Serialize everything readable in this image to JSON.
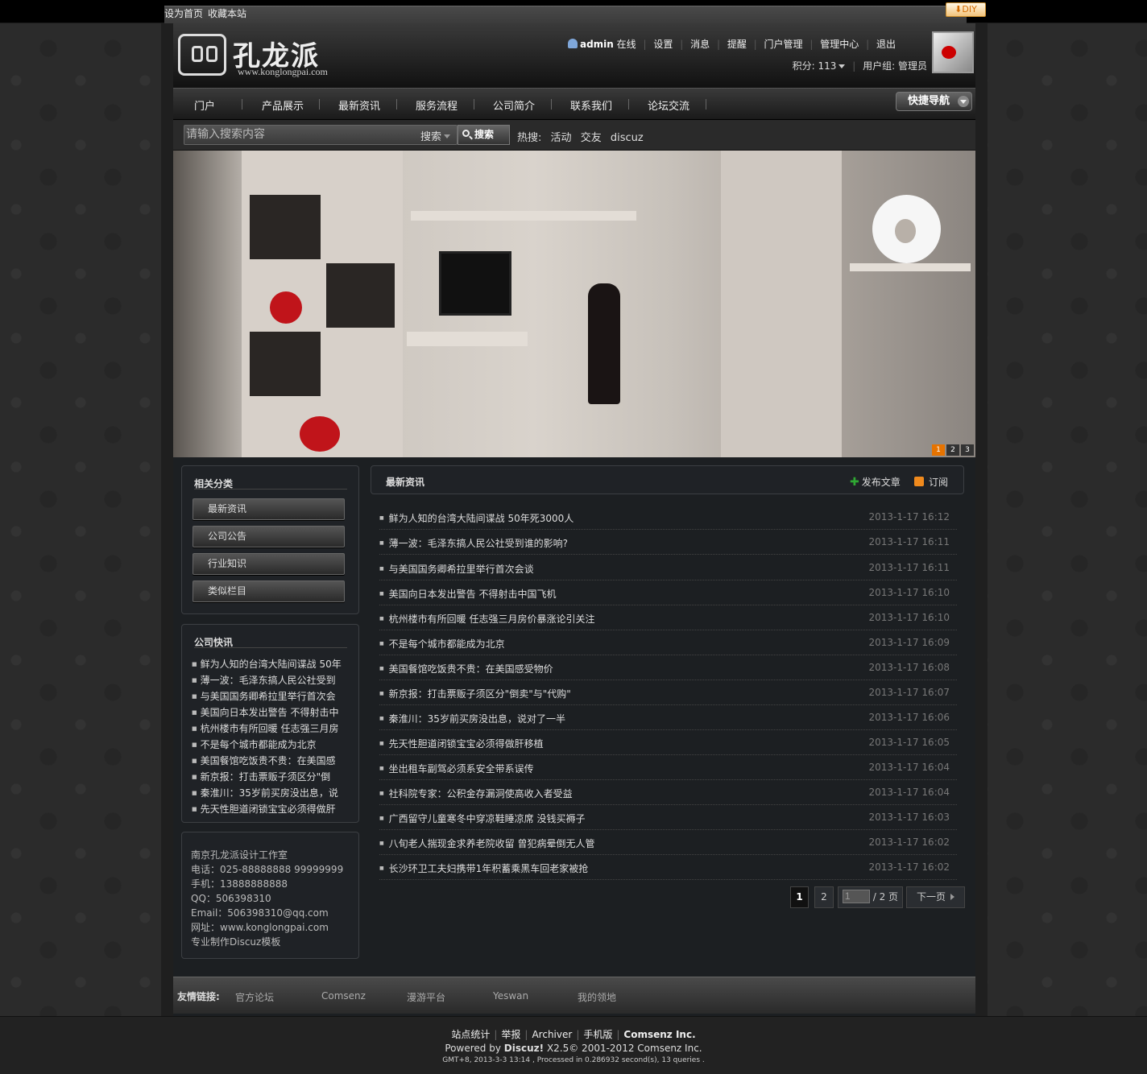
{
  "topbar": {
    "set_home": "设为首页",
    "bookmark": "收藏本站",
    "diy": "DIY"
  },
  "logo": {
    "name": "孔龙派",
    "url": "www.konglongpai.com"
  },
  "user": {
    "name": "admin",
    "status": "在线",
    "menu": [
      "设置",
      "消息",
      "提醒",
      "门户管理",
      "管理中心",
      "退出"
    ],
    "points": "积分: 113",
    "group": "用户组: 管理员"
  },
  "nav": {
    "items": [
      "门户",
      "产品展示",
      "最新资讯",
      "服务流程",
      "公司简介",
      "联系我们",
      "论坛交流"
    ],
    "quick": "快捷导航"
  },
  "search": {
    "placeholder": "请输入搜索内容",
    "type": "搜索",
    "button": "搜索",
    "hot_label": "热搜:",
    "hot": [
      "活动",
      "交友",
      "discuz"
    ]
  },
  "slider": {
    "pages": [
      "1",
      "2",
      "3"
    ],
    "active": 0
  },
  "sidebar": {
    "categories_title": "相关分类",
    "categories": [
      "最新资讯",
      "公司公告",
      "行业知识",
      "类似栏目"
    ],
    "flash_title": "公司快讯",
    "flash": [
      "鲜为人知的台湾大陆间谍战 50年",
      "薄一波：毛泽东搞人民公社受到",
      "与美国国务卿希拉里举行首次会",
      "美国向日本发出警告 不得射击中",
      "杭州楼市有所回暖 任志强三月房",
      "不是每个城市都能成为北京",
      "美国餐馆吃饭贵不贵：在美国感",
      "新京报：打击票贩子须区分\"倒",
      "秦淮川：35岁前买房没出息，说",
      "先天性胆道闭锁宝宝必须得做肝"
    ],
    "contact": [
      "南京孔龙派设计工作室",
      "电话：025-88888888 99999999",
      "手机：13888888888",
      "QQ：506398310",
      "Email：506398310@qq.com",
      "网址：www.konglongpai.com",
      "专业制作Discuz模板"
    ]
  },
  "main": {
    "title": "最新资讯",
    "post": "发布文章",
    "rss": "订阅",
    "articles": [
      {
        "title": "鲜为人知的台湾大陆间谍战 50年死3000人",
        "date": "2013-1-17 16:12"
      },
      {
        "title": "薄一波：毛泽东搞人民公社受到谁的影响?",
        "date": "2013-1-17 16:11"
      },
      {
        "title": "与美国国务卿希拉里举行首次会谈",
        "date": "2013-1-17 16:11"
      },
      {
        "title": "美国向日本发出警告 不得射击中国飞机",
        "date": "2013-1-17 16:10"
      },
      {
        "title": "杭州楼市有所回暖 任志强三月房价暴涨论引关注",
        "date": "2013-1-17 16:10"
      },
      {
        "title": "不是每个城市都能成为北京",
        "date": "2013-1-17 16:09"
      },
      {
        "title": "美国餐馆吃饭贵不贵：在美国感受物价",
        "date": "2013-1-17 16:08"
      },
      {
        "title": "新京报：打击票贩子须区分\"倒卖\"与\"代购\"",
        "date": "2013-1-17 16:07"
      },
      {
        "title": "秦淮川：35岁前买房没出息，说对了一半",
        "date": "2013-1-17 16:06"
      },
      {
        "title": "先天性胆道闭锁宝宝必须得做肝移植",
        "date": "2013-1-17 16:05"
      },
      {
        "title": "坐出租车副驾必须系安全带系误传",
        "date": "2013-1-17 16:04"
      },
      {
        "title": "社科院专家：公积金存漏洞使高收入者受益",
        "date": "2013-1-17 16:04"
      },
      {
        "title": "广西留守儿童寒冬中穿凉鞋睡凉席 没钱买褥子",
        "date": "2013-1-17 16:03"
      },
      {
        "title": "八旬老人揣现金求养老院收留 曾犯病晕倒无人管",
        "date": "2013-1-17 16:02"
      },
      {
        "title": "长沙环卫工夫妇携带1年积蓄乘黑车回老家被抢",
        "date": "2013-1-17 16:02"
      }
    ],
    "pager": {
      "p1": "1",
      "p2": "2",
      "input": "1",
      "total": "/ 2 页",
      "next": "下一页"
    }
  },
  "friend_links": {
    "label": "友情链接:",
    "items": [
      "官方论坛",
      "Comsenz",
      "漫游平台",
      "Yeswan",
      "我的领地"
    ]
  },
  "footer": {
    "links": [
      "站点统计",
      "举报",
      "Archiver",
      "手机版",
      "Comsenz Inc."
    ],
    "powered_prefix": "Powered by",
    "powered_brand": "Discuz!",
    "powered_suffix": "X2.5© 2001-2012 Comsenz Inc.",
    "stats": "GMT+8, 2013-3-3 13:14 , Processed in 0.286932 second(s), 13 queries ."
  }
}
